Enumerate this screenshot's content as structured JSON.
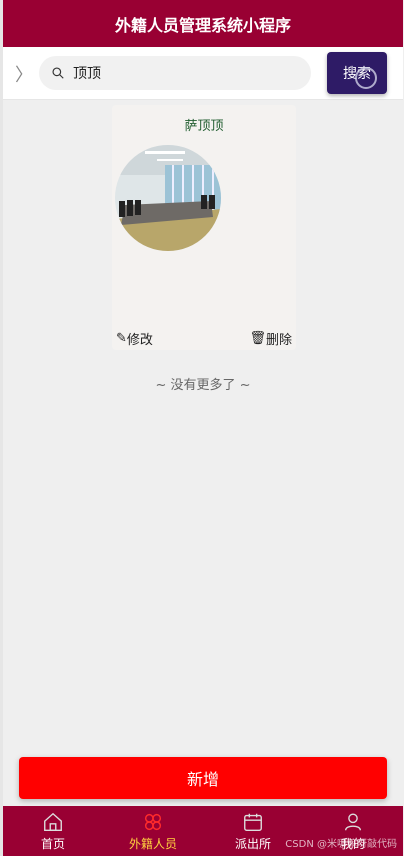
{
  "header": {
    "title": "外籍人员管理系统小程序"
  },
  "search": {
    "value": "顶顶",
    "button_label": "搜索"
  },
  "card": {
    "name": "萨顶顶",
    "edit_label": "修改",
    "delete_label": "删除"
  },
  "list": {
    "no_more_text": "~ 没有更多了 ~"
  },
  "actions": {
    "add_label": "新增"
  },
  "tabbar": {
    "items": [
      {
        "label": "首页",
        "icon": "home-icon"
      },
      {
        "label": "外籍人员",
        "icon": "foreigners-icon"
      },
      {
        "label": "派出所",
        "icon": "calendar-icon"
      },
      {
        "label": "我的",
        "icon": "user-icon"
      }
    ],
    "active_index": 1
  },
  "watermark": "CSDN @米哪嘛呀敲代码",
  "colors": {
    "primary": "#990033",
    "search_button": "#2e1b66",
    "add_button": "#ff0000",
    "active_tab": "#ffd23f"
  }
}
